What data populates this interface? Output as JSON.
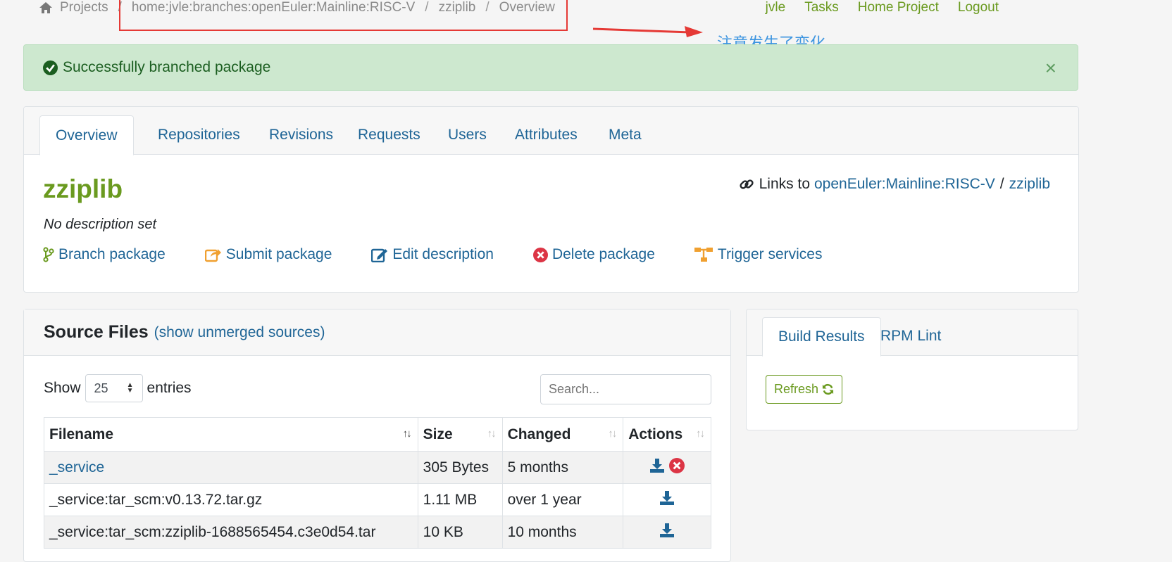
{
  "breadcrumb": {
    "items": [
      "Projects",
      "home:jvle:branches:openEuler:Mainline:RISC-V",
      "zziplib",
      "Overview"
    ],
    "separator": "/"
  },
  "user_nav": [
    "jvle",
    "Tasks",
    "Home Project",
    "Logout"
  ],
  "annotation": {
    "text": "注意发生了变化",
    "color": "#3d95e0",
    "box_color": "#e53935"
  },
  "alert": {
    "message": "Successfully branched package",
    "close": "×"
  },
  "package": {
    "tabs": [
      "Overview",
      "Repositories",
      "Revisions",
      "Requests",
      "Users",
      "Attributes",
      "Meta"
    ],
    "active_tab": "Overview",
    "name": "zziplib",
    "description": "No description set",
    "links_to": {
      "prefix": "Links to",
      "project": "openEuler:Mainline:RISC-V",
      "separator": "/",
      "package": "zziplib"
    },
    "actions": [
      "Branch package",
      "Submit package",
      "Edit description",
      "Delete package",
      "Trigger services"
    ]
  },
  "source_files": {
    "title": "Source Files",
    "unmerged_link": "(show unmerged sources)",
    "show_label": "Show",
    "entries_label": "entries",
    "page_size": "25",
    "search_placeholder": "Search...",
    "columns": [
      "Filename",
      "Size",
      "Changed",
      "Actions"
    ],
    "rows": [
      {
        "filename": "_service",
        "size": "305 Bytes",
        "changed": "5 months",
        "link": true,
        "deletable": true
      },
      {
        "filename": "_service:tar_scm:v0.13.72.tar.gz",
        "size": "1.11 MB",
        "changed": "over 1 year",
        "link": false,
        "deletable": false
      },
      {
        "filename": "_service:tar_scm:zziplib-1688565454.c3e0d54.tar",
        "size": "10 KB",
        "changed": "10 months",
        "link": false,
        "deletable": false
      }
    ]
  },
  "build": {
    "tabs": [
      "Build Results",
      "RPM Lint"
    ],
    "active_tab": "Build Results",
    "refresh_label": "Refresh"
  },
  "colors": {
    "brand_green": "#6a9a1f",
    "link_blue": "#1f6596",
    "alert_bg": "#cde8cf",
    "danger": "#dc3545"
  }
}
